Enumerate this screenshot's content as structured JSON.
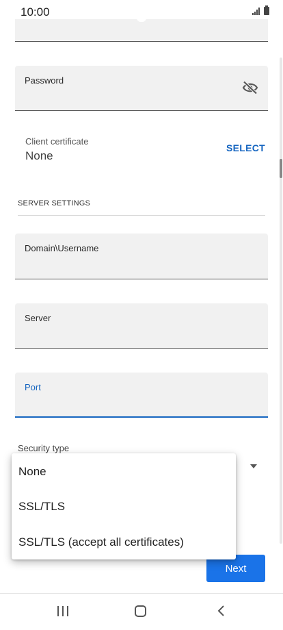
{
  "status_bar": {
    "time": "10:00"
  },
  "form": {
    "password_label": "Password",
    "client_certificate_label": "Client certificate",
    "client_certificate_value": "None",
    "select_button": "SELECT",
    "server_settings_header": "SERVER SETTINGS",
    "domain_username_label": "Domain\\Username",
    "server_label": "Server",
    "port_label": "Port",
    "security_type_label": "Security type",
    "next_button": "Next"
  },
  "security_menu": {
    "options": [
      "None",
      "SSL/TLS",
      "SSL/TLS (accept all certificates)"
    ]
  },
  "colors": {
    "accent": "#1565c0",
    "button_bg": "#1a73e8",
    "field_bg": "#f1f1f1"
  },
  "icons": {
    "password_toggle": "eye-off-icon",
    "nav_recent": "recent-apps-icon",
    "nav_home": "home-icon",
    "nav_back": "back-icon"
  }
}
